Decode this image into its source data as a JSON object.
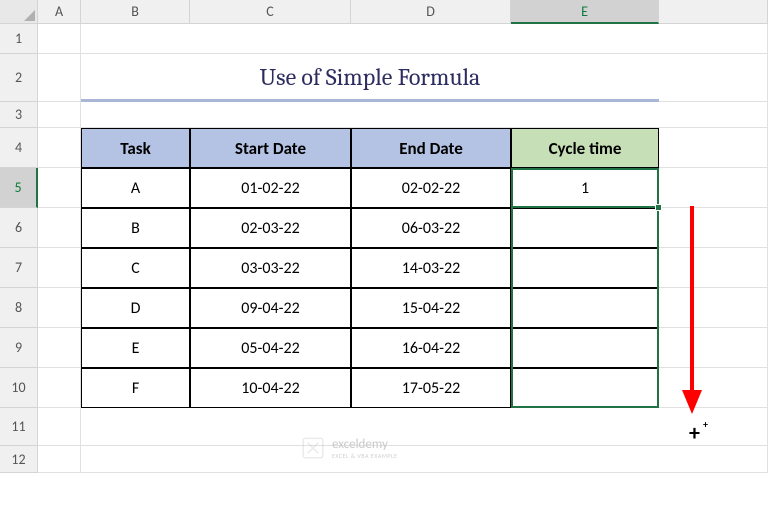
{
  "columns": [
    "A",
    "B",
    "C",
    "D",
    "E"
  ],
  "rows": [
    "1",
    "2",
    "3",
    "4",
    "5",
    "6",
    "7",
    "8",
    "9",
    "10",
    "11",
    "12"
  ],
  "activeColumn": "E",
  "activeRow": "5",
  "title": "Use of Simple Formula",
  "headers": {
    "task": "Task",
    "start": "Start Date",
    "end": "End Date",
    "cycle": "Cycle time"
  },
  "data_rows": [
    {
      "task": "A",
      "start": "01-02-22",
      "end": "02-02-22",
      "cycle": "1"
    },
    {
      "task": "B",
      "start": "02-03-22",
      "end": "06-03-22",
      "cycle": ""
    },
    {
      "task": "C",
      "start": "03-03-22",
      "end": "14-03-22",
      "cycle": ""
    },
    {
      "task": "D",
      "start": "09-04-22",
      "end": "15-04-22",
      "cycle": ""
    },
    {
      "task": "E",
      "start": "05-04-22",
      "end": "16-04-22",
      "cycle": ""
    },
    {
      "task": "F",
      "start": "10-04-22",
      "end": "17-05-22",
      "cycle": ""
    }
  ],
  "watermark": {
    "brand": "exceldemy",
    "tag": "EXCEL & VBA EXAMPLE"
  },
  "colors": {
    "header_blue": "#b4c3e4",
    "header_green": "#c7dfb6",
    "title_underline": "#a9b6d6",
    "selection": "#217346",
    "arrow": "#ff0000"
  }
}
